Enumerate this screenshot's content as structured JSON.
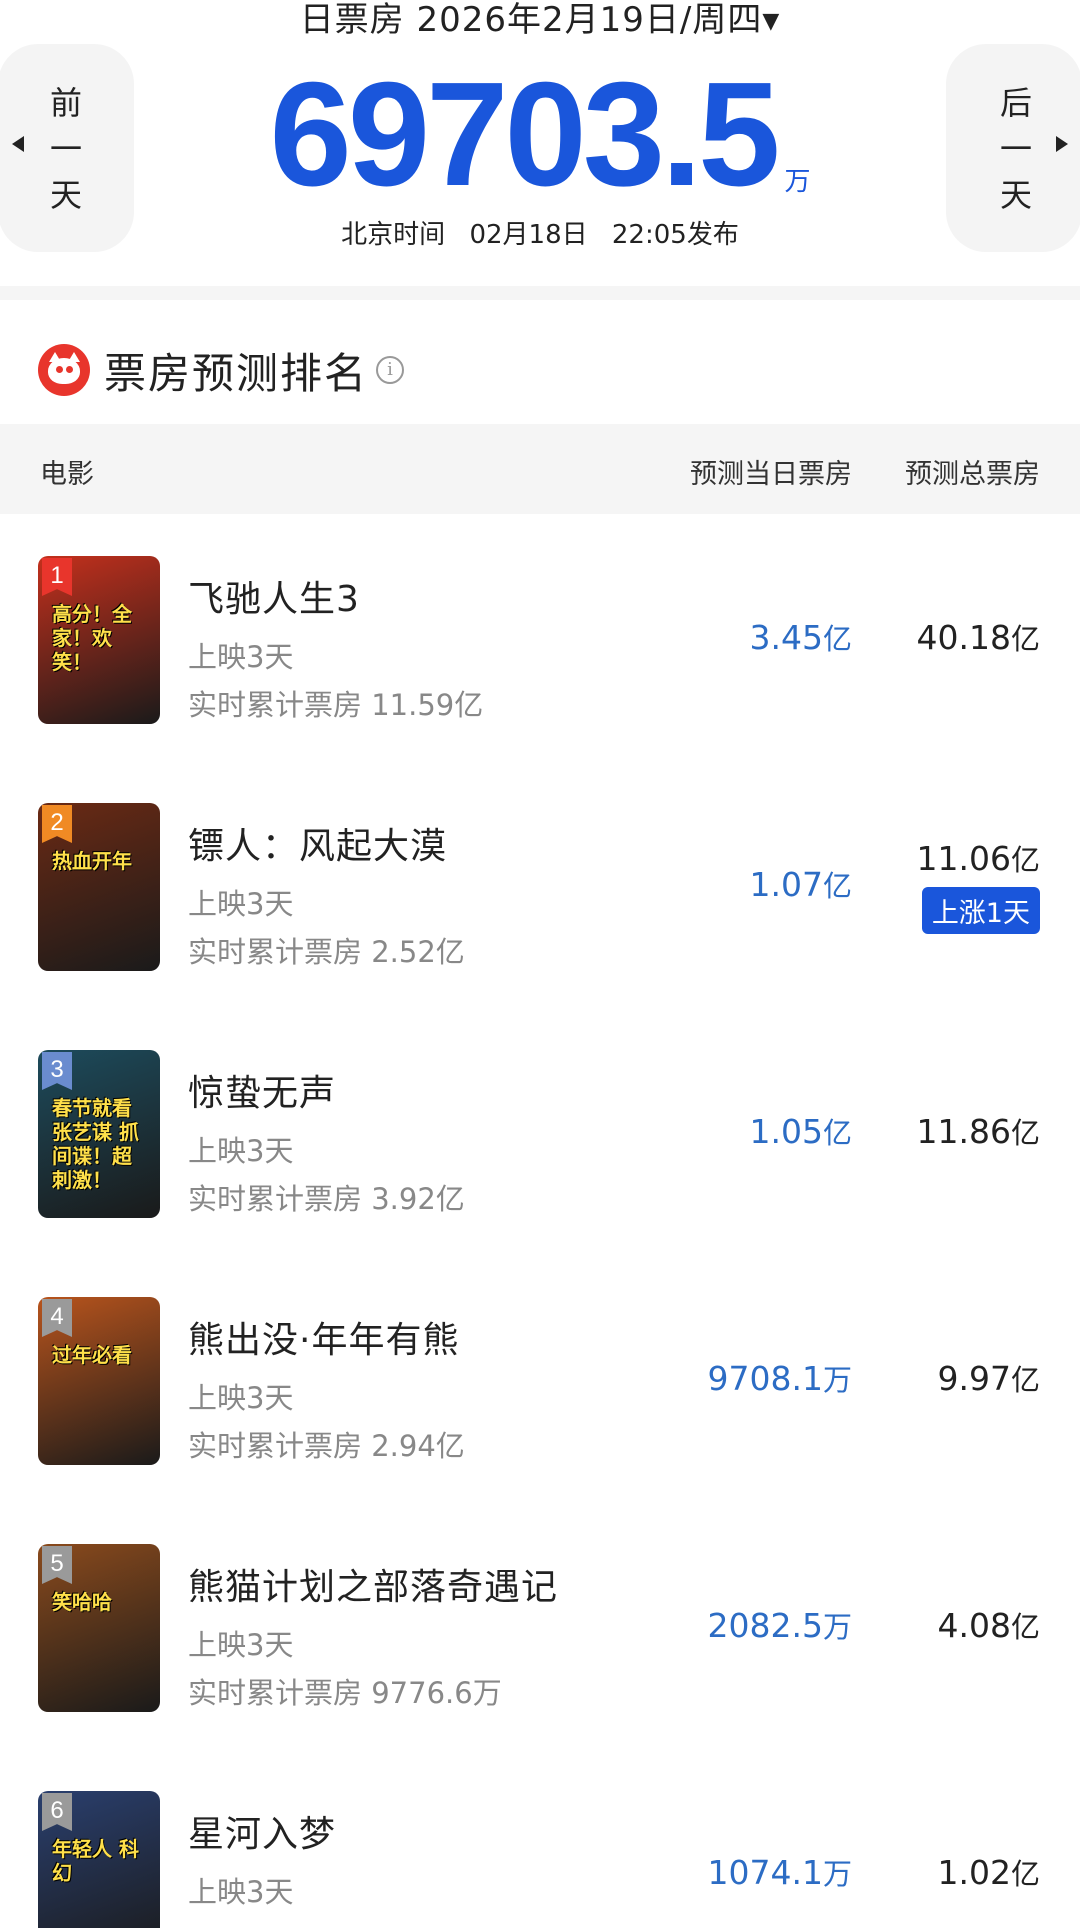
{
  "header": {
    "date_label": "日票房",
    "date_value": "2026年2月19日/周四",
    "prev_label": [
      "前",
      "一",
      "天"
    ],
    "next_label": [
      "后",
      "一",
      "天"
    ],
    "total_value": "69703.5",
    "total_unit": "万",
    "release_tz": "北京时间",
    "release_date": "02月18日",
    "release_time": "22:05发布"
  },
  "section": {
    "title": "票房预测排名",
    "info_icon": "info-icon"
  },
  "table": {
    "col_movie": "电影",
    "col_daily": "预测当日票房",
    "col_total": "预测总票房"
  },
  "movies": [
    {
      "rank": "1",
      "name": "飞驰人生3",
      "days": "上映3天",
      "cumulative": "实时累计票房 11.59亿",
      "daily_num": "3.45",
      "daily_unit": "亿",
      "total_num": "40.18",
      "total_unit": "亿",
      "badge": "",
      "poster_text": "高分！全家！欢笑！",
      "rank_color": "#e8352c",
      "poster_color": "#c4301c"
    },
    {
      "rank": "2",
      "name": "镖人：风起大漠",
      "days": "上映3天",
      "cumulative": "实时累计票房 2.52亿",
      "daily_num": "1.07",
      "daily_unit": "亿",
      "total_num": "11.06",
      "total_unit": "亿",
      "badge": "上涨1天",
      "poster_text": "热血开年",
      "rank_color": "#f08a24",
      "poster_color": "#6b2a14"
    },
    {
      "rank": "3",
      "name": "惊蛰无声",
      "days": "上映3天",
      "cumulative": "实时累计票房 3.92亿",
      "daily_num": "1.05",
      "daily_unit": "亿",
      "total_num": "11.86",
      "total_unit": "亿",
      "badge": "",
      "poster_text": "春节就看张艺谋 抓间谍！超刺激！",
      "rank_color": "#6a8ccf",
      "poster_color": "#1d4b5c"
    },
    {
      "rank": "4",
      "name": "熊出没·年年有熊",
      "days": "上映3天",
      "cumulative": "实时累计票房 2.94亿",
      "daily_num": "9708.1",
      "daily_unit": "万",
      "total_num": "9.97",
      "total_unit": "亿",
      "badge": "",
      "poster_text": "过年必看",
      "rank_color": "#9a9a9a",
      "poster_color": "#b8541c"
    },
    {
      "rank": "5",
      "name": "熊猫计划之部落奇遇记",
      "days": "上映3天",
      "cumulative": "实时累计票房 9776.6万",
      "daily_num": "2082.5",
      "daily_unit": "万",
      "total_num": "4.08",
      "total_unit": "亿",
      "badge": "",
      "poster_text": "笑哈哈",
      "rank_color": "#9a9a9a",
      "poster_color": "#8a4a1c"
    },
    {
      "rank": "6",
      "name": "星河入梦",
      "days": "上映3天",
      "cumulative": "",
      "daily_num": "1074.1",
      "daily_unit": "万",
      "total_num": "1.02",
      "total_unit": "亿",
      "badge": "",
      "poster_text": "年轻人 科幻",
      "rank_color": "#9a9a9a",
      "poster_color": "#2a3f6e"
    }
  ]
}
